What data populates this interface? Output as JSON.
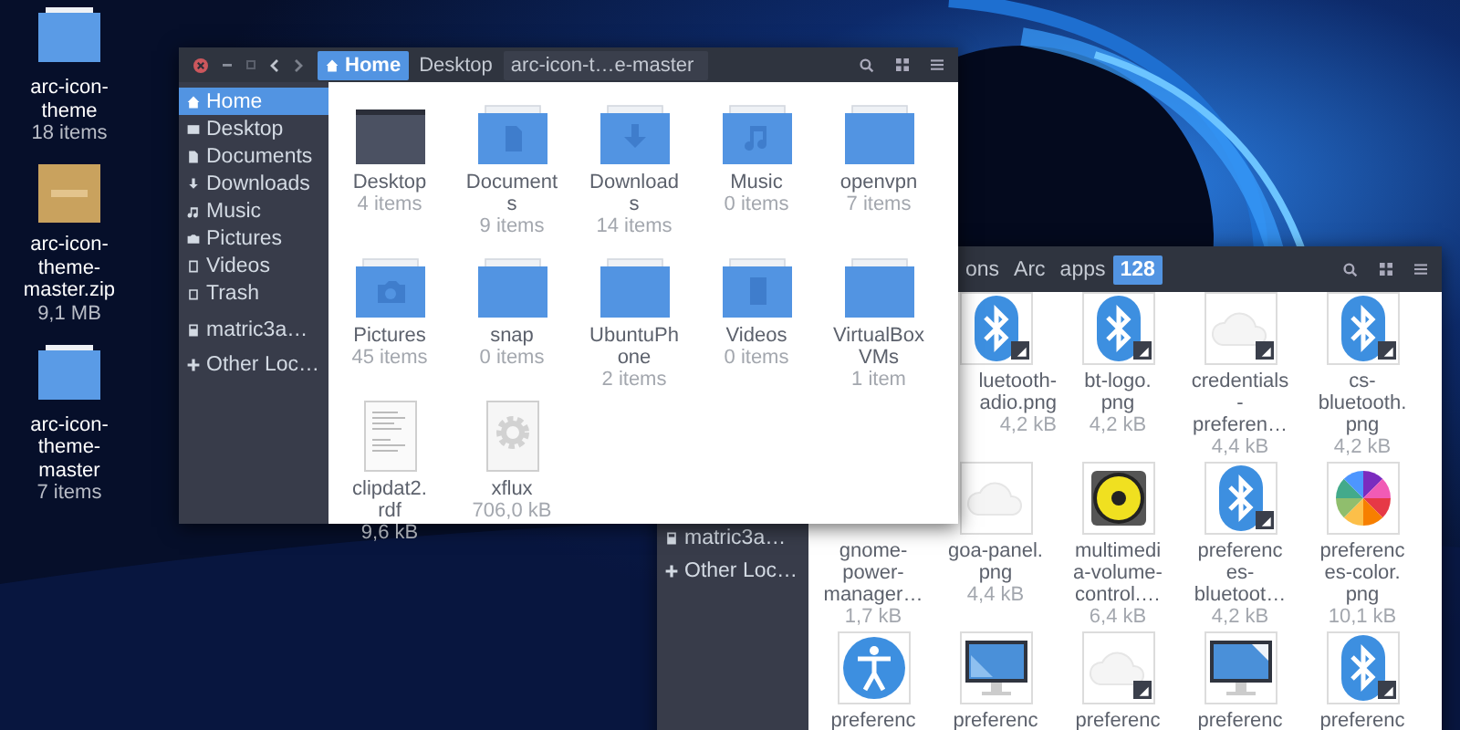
{
  "desktop_icons": [
    {
      "kind": "folder",
      "name": [
        "arc-icon-",
        "theme"
      ],
      "info": "18 items"
    },
    {
      "kind": "archive",
      "name": [
        "arc-icon-",
        "theme-",
        "master.zip"
      ],
      "info": "9,1 MB"
    },
    {
      "kind": "folder",
      "name": [
        "arc-icon-",
        "theme-",
        "master"
      ],
      "info": "7 items"
    }
  ],
  "back_window": {
    "path": [
      {
        "label": "ons",
        "selected": false
      },
      {
        "label": "Arc",
        "selected": false
      },
      {
        "label": "apps",
        "selected": false
      },
      {
        "label": "128",
        "selected": true
      }
    ],
    "sidebar": [
      {
        "label": "matric3a…",
        "kind": "drive",
        "selected": false
      },
      {
        "label": "Other Loc…",
        "kind": "plus",
        "selected": false
      }
    ],
    "items": [
      {
        "kind": "bluetooth",
        "link": true,
        "name": [
          "luetooth-",
          "adio.png"
        ],
        "info": "4,2 kB"
      },
      {
        "kind": "bluetooth",
        "link": true,
        "name": [
          "bt-logo.",
          "png"
        ],
        "info": "4,2 kB"
      },
      {
        "kind": "cloud",
        "link": true,
        "name": [
          "credentials",
          "-",
          "preferen…"
        ],
        "info": "4,4 kB"
      },
      {
        "kind": "bluetooth",
        "link": true,
        "name": [
          "cs-",
          "bluetooth.",
          "png"
        ],
        "info": "4,2 kB"
      },
      {
        "name": [
          "gnome-",
          "power-",
          "manager…"
        ],
        "info": "1,7 kB"
      },
      {
        "kind": "cloud",
        "link": false,
        "name": [
          "goa-panel.",
          "png"
        ],
        "info": "4,4 kB"
      },
      {
        "kind": "speaker",
        "link": false,
        "name": [
          "multimedi",
          "a-volume-",
          "control.…"
        ],
        "info": "6,4 kB"
      },
      {
        "kind": "bluetooth",
        "link": true,
        "name": [
          "preferenc",
          "es-",
          "bluetoot…"
        ],
        "info": "4,2 kB"
      },
      {
        "kind": "wheel",
        "link": false,
        "name": [
          "preferenc",
          "es-color.",
          "png"
        ],
        "info": "10,1 kB"
      },
      {
        "kind": "person",
        "link": false,
        "name": [
          "preferenc"
        ]
      },
      {
        "kind": "monitor",
        "link": false,
        "name": [
          "preferenc"
        ]
      },
      {
        "kind": "cloud",
        "link": true,
        "name": [
          "preferenc"
        ]
      },
      {
        "kind": "monitor-page",
        "link": false,
        "name": [
          "preferenc"
        ]
      },
      {
        "kind": "bluetooth",
        "link": true,
        "name": [
          "preferenc"
        ]
      }
    ]
  },
  "front_window": {
    "path": [
      {
        "label": "Home",
        "kind": "home",
        "selected": true
      },
      {
        "label": "Desktop",
        "kind": "folder",
        "selected": false
      },
      {
        "label": "arc-icon-t…e-master",
        "kind": "folder",
        "selected": false
      }
    ],
    "sidebar": [
      {
        "label": "Home",
        "kind": "home",
        "selected": true
      },
      {
        "label": "Desktop",
        "kind": "desktop",
        "selected": false
      },
      {
        "label": "Documents",
        "kind": "document",
        "selected": false
      },
      {
        "label": "Downloads",
        "kind": "download",
        "selected": false
      },
      {
        "label": "Music",
        "kind": "music",
        "selected": false
      },
      {
        "label": "Pictures",
        "kind": "camera",
        "selected": false
      },
      {
        "label": "Videos",
        "kind": "film",
        "selected": false
      },
      {
        "label": "Trash",
        "kind": "trash",
        "selected": false
      },
      {
        "label": "matric3a…",
        "kind": "drive",
        "selected": false
      },
      {
        "label": "Other Loc…",
        "kind": "plus",
        "selected": false
      }
    ],
    "items": [
      {
        "kind": "folder-dark",
        "name": [
          "Desktop"
        ],
        "info": "4 items"
      },
      {
        "kind": "folder-doc",
        "name": [
          "Document",
          "s"
        ],
        "info": "9 items"
      },
      {
        "kind": "folder-down",
        "name": [
          "Download",
          "s"
        ],
        "info": "14 items"
      },
      {
        "kind": "folder-music",
        "name": [
          "Music"
        ],
        "info": "0 items"
      },
      {
        "kind": "folder",
        "name": [
          "openvpn"
        ],
        "info": "7 items"
      },
      {
        "kind": "folder-camera",
        "name": [
          "Pictures"
        ],
        "info": "45 items"
      },
      {
        "kind": "folder",
        "name": [
          "snap"
        ],
        "info": "0 items"
      },
      {
        "kind": "folder",
        "name": [
          "UbuntuPh",
          "one"
        ],
        "info": "2 items"
      },
      {
        "kind": "folder-film",
        "name": [
          "Videos"
        ],
        "info": "0 items"
      },
      {
        "kind": "folder",
        "name": [
          "VirtualBox",
          "VMs"
        ],
        "info": "1 item"
      },
      {
        "kind": "text-file",
        "name": [
          "clipdat2.",
          "rdf"
        ],
        "info": "9,6 kB"
      },
      {
        "kind": "gear-file",
        "name": [
          "xflux"
        ],
        "info": "706,0 kB"
      }
    ]
  }
}
